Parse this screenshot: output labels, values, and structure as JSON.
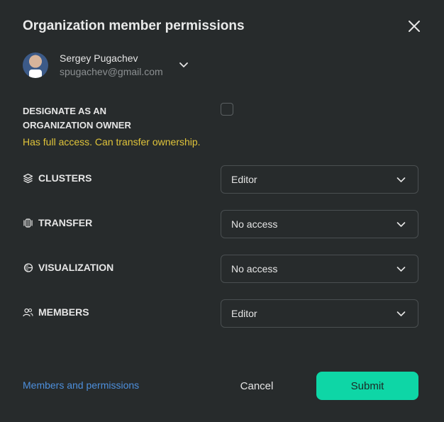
{
  "dialog": {
    "title": "Organization member permissions",
    "close_icon": "close-icon"
  },
  "user": {
    "name": "Sergey Pugachev",
    "email": "spugachev@gmail.com"
  },
  "owner": {
    "label": "DESIGNATE AS AN ORGANIZATION OWNER",
    "checked": false,
    "note": "Has full access. Can transfer ownership.",
    "note_color": "#e0c43a"
  },
  "permissions": [
    {
      "label": "CLUSTERS",
      "icon": "layers-icon",
      "value": "Editor"
    },
    {
      "label": "TRANSFER",
      "icon": "transfer-icon",
      "value": "No access"
    },
    {
      "label": "VISUALIZATION",
      "icon": "visualization-icon",
      "value": "No access"
    },
    {
      "label": "MEMBERS",
      "icon": "members-icon",
      "value": "Editor"
    }
  ],
  "footer": {
    "link": "Members and permissions",
    "cancel": "Cancel",
    "submit": "Submit",
    "accent_color": "#0ed6a6",
    "link_color": "#4d8fdc"
  }
}
